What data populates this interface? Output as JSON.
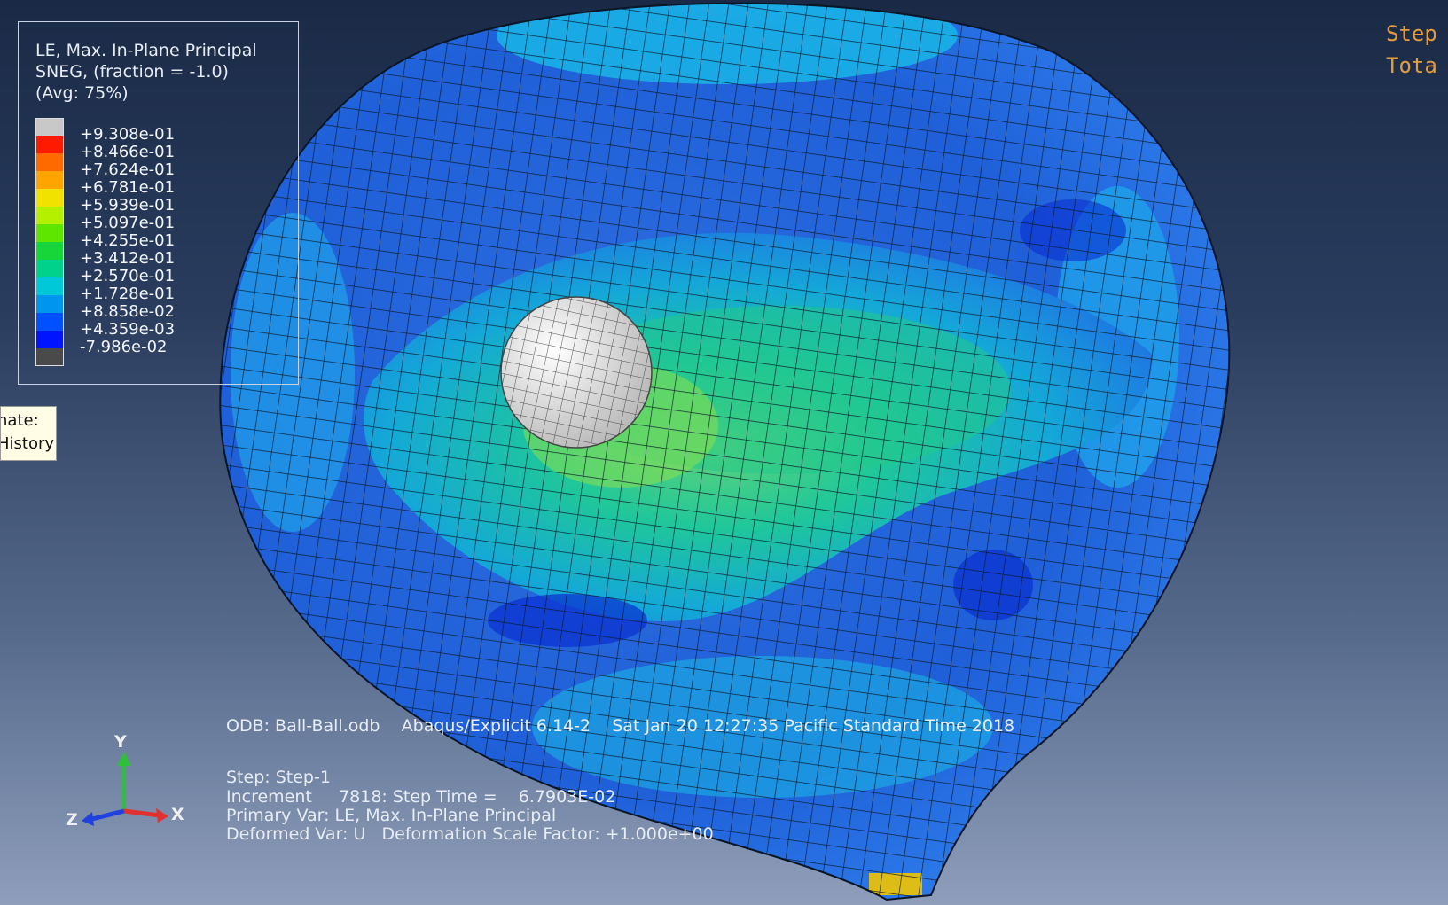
{
  "legend": {
    "title_line1": "LE, Max. In-Plane Principal",
    "title_line2": "SNEG, (fraction = -1.0)",
    "title_line3": "(Avg: 75%)",
    "values": [
      "+9.308e-01",
      "+8.466e-01",
      "+7.624e-01",
      "+6.781e-01",
      "+5.939e-01",
      "+5.097e-01",
      "+4.255e-01",
      "+3.412e-01",
      "+2.570e-01",
      "+1.728e-01",
      "+8.858e-02",
      "+4.359e-03",
      "-7.986e-02"
    ],
    "colors": [
      "#c8c8c8",
      "#ff1a00",
      "#ff6a00",
      "#ffa400",
      "#f2e200",
      "#b4f000",
      "#5fe600",
      "#16d63a",
      "#00d28c",
      "#00c8d8",
      "#0096f0",
      "#0050ff",
      "#0014ff",
      "#4a4a4a"
    ]
  },
  "tooltip": {
    "line1": "nate:",
    "line2": "History"
  },
  "status_top": {
    "line1": "Step",
    "line2": "Tota"
  },
  "info": {
    "odb_line": "ODB: Ball-Ball.odb    Abaqus/Explicit 6.14-2    Sat Jan 20 12:27:35 Pacific Standard Time 2018",
    "step_line": "Step: Step-1",
    "increment_line": "Increment     7818: Step Time =    6.7903E-02",
    "primary_line": "Primary Var: LE, Max. In-Plane Principal",
    "deformed_line": "Deformed Var: U   Deformation Scale Factor: +1.000e+00"
  },
  "triad": {
    "y": "Y",
    "z": "Z",
    "x": "X"
  },
  "colors": {
    "background_top": "#1a2a46",
    "background_bottom": "#8e9ebb",
    "status_orange": "#e49d3c"
  }
}
